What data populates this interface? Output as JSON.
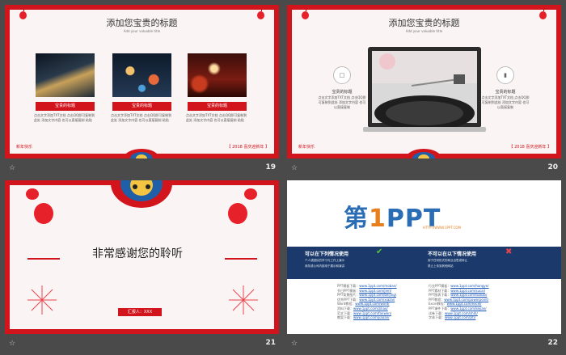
{
  "slides": [
    {
      "number": "19",
      "title": "添加您宝贵的标题",
      "subtitle": "Add your valuable title",
      "cards": [
        {
          "caption": "宝贵的标题",
          "desc": "点击文字添加TXT文档 点击QQ即可复制到此处 添加文字内容 也可以直接复制 粘贴"
        },
        {
          "caption": "宝贵的标题",
          "desc": "点击文字添加TXT文档 点击QQ即可复制到此处 添加文字内容 也可以直接复制 粘贴"
        },
        {
          "caption": "宝贵的标题",
          "desc": "点击文字添加TXT文档 点击QQ即可复制到此处 添加文字内容 也可以直接复制 粘贴"
        }
      ],
      "corner_left": "新年快乐",
      "corner_right": "【 2018 喜庆迎新年 】"
    },
    {
      "number": "20",
      "title": "添加您宝贵的标题",
      "subtitle": "Add your valuable title",
      "left_title": "宝贵的标题",
      "left_desc": "点击文字添加TXT文档 点击QQ即可复制到此处 添加文字内容 也可以直接复制",
      "right_title": "宝贵的标题",
      "right_desc": "点击文字添加TXT文档 点击QQ即可复制到此处 添加文字内容 也可以直接复制",
      "corner_left": "新年快乐",
      "corner_right": "【 2018 喜庆迎新年 】"
    },
    {
      "number": "21",
      "thanks": "非常感谢您的聆听",
      "presenter": "汇报人：XXX"
    },
    {
      "number": "22",
      "logo_main": "第",
      "logo_one": "1",
      "logo_rest": "PPT",
      "logo_url": "HTTP://WWW.1PPT.COM",
      "can_use_title": "可以在下列情况使用",
      "can_use_lines": [
        "个人或团队的学习与工作上演示",
        "商务或公司内部用于展示和演讲"
      ],
      "cannot_use_title": "不可以在以下情况使用",
      "cannot_use_lines": [
        "用于任何形式的商业出售或转让",
        "禁止上传到其他网站"
      ],
      "links_left": [
        {
          "label": "PPT模板下载：",
          "url": "www.1ppt.com/moban/"
        },
        {
          "label": "节日PPT模板：",
          "url": "www.1ppt.com/jieri/"
        },
        {
          "label": "PPT背景图片：",
          "url": "www.1ppt.com/beijing/"
        },
        {
          "label": "优秀PPT下载：",
          "url": "www.1ppt.com/xiazai/"
        },
        {
          "label": "Word教程：",
          "url": "www.1ppt.com/word/"
        },
        {
          "label": "资料下载：",
          "url": "www.1ppt.com/ziliao/"
        },
        {
          "label": "范文下载：",
          "url": "www.1ppt.com/fanwen/"
        },
        {
          "label": "教案下载：",
          "url": "www.1ppt.com/jiaoan/"
        }
      ],
      "links_right": [
        {
          "label": "行业PPT模板：",
          "url": "www.1ppt.com/hangye/"
        },
        {
          "label": "PPT素材下载：",
          "url": "www.1ppt.com/sucai/"
        },
        {
          "label": "PPT图表下载：",
          "url": "www.1ppt.com/tubiao/"
        },
        {
          "label": "PPT教程：",
          "url": "www.1ppt.com/powerpoint/"
        },
        {
          "label": "Excel教程：",
          "url": "www.1ppt.com/excel/"
        },
        {
          "label": "PPT课件下载：",
          "url": "www.1ppt.com/kejian/"
        },
        {
          "label": "试卷下载：",
          "url": "www.1ppt.com/shiti/"
        },
        {
          "label": "字体下载：",
          "url": "www.1ppt.com/ziti/"
        }
      ]
    }
  ],
  "star_glyph": "☆"
}
